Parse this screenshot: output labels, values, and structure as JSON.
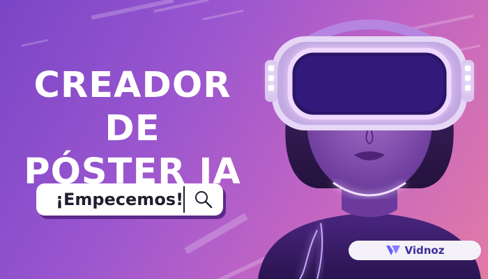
{
  "headline": {
    "line1": "CREADOR DE",
    "line2": "PÓSTER IA"
  },
  "cta": {
    "label": "¡Empecemos!",
    "icon": "search-icon"
  },
  "brand": {
    "name": "Vidnoz"
  },
  "colors": {
    "background_start": "#7a45c6",
    "background_end": "#e27aa6",
    "headset_glow": "#e7c6ff",
    "text": "#ffffff",
    "button_shadow": "#5a2a8a",
    "brand_text": "#3b2f9b"
  }
}
